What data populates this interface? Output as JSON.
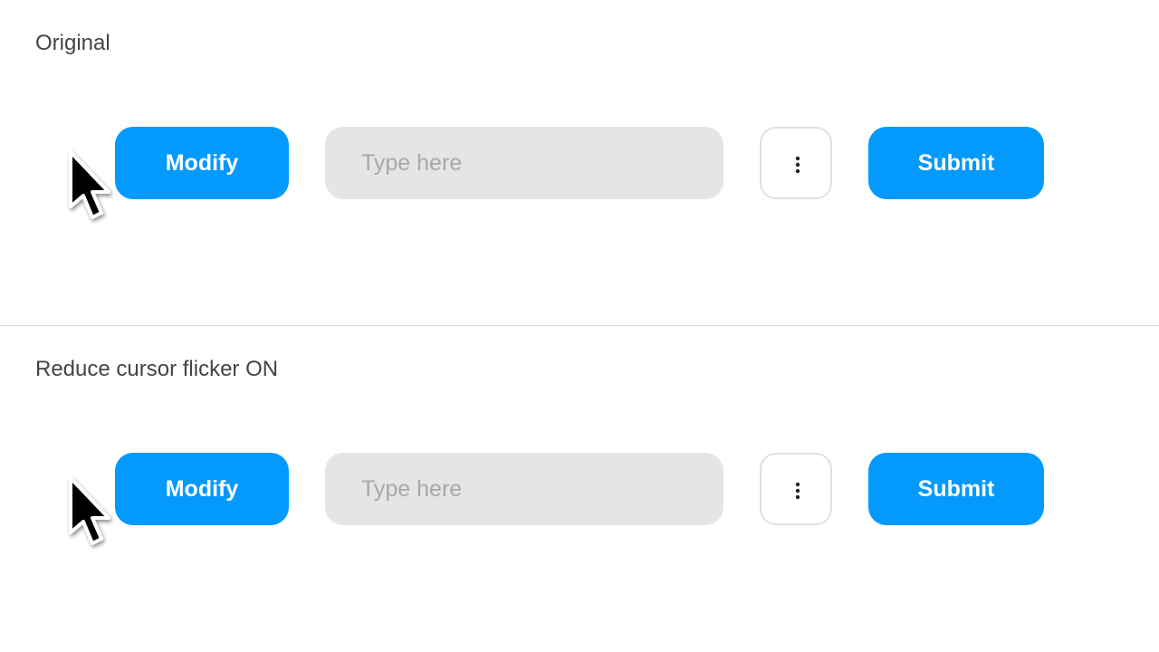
{
  "sections": [
    {
      "title": "Original",
      "modify_label": "Modify",
      "input_placeholder": "Type here",
      "input_value": "",
      "more_icon": "more-vertical-icon",
      "submit_label": "Submit",
      "cursor_icon": "arrow-pointer-icon"
    },
    {
      "title": "Reduce cursor flicker ON",
      "modify_label": "Modify",
      "input_placeholder": "Type here",
      "input_value": "",
      "more_icon": "more-vertical-icon",
      "submit_label": "Submit",
      "cursor_icon": "arrow-pointer-icon"
    }
  ],
  "colors": {
    "primary_button": "#0399fd",
    "input_background": "#e5e5e5",
    "placeholder": "#a8a8a8",
    "title_text": "#444444",
    "divider": "#dcdcdc"
  }
}
